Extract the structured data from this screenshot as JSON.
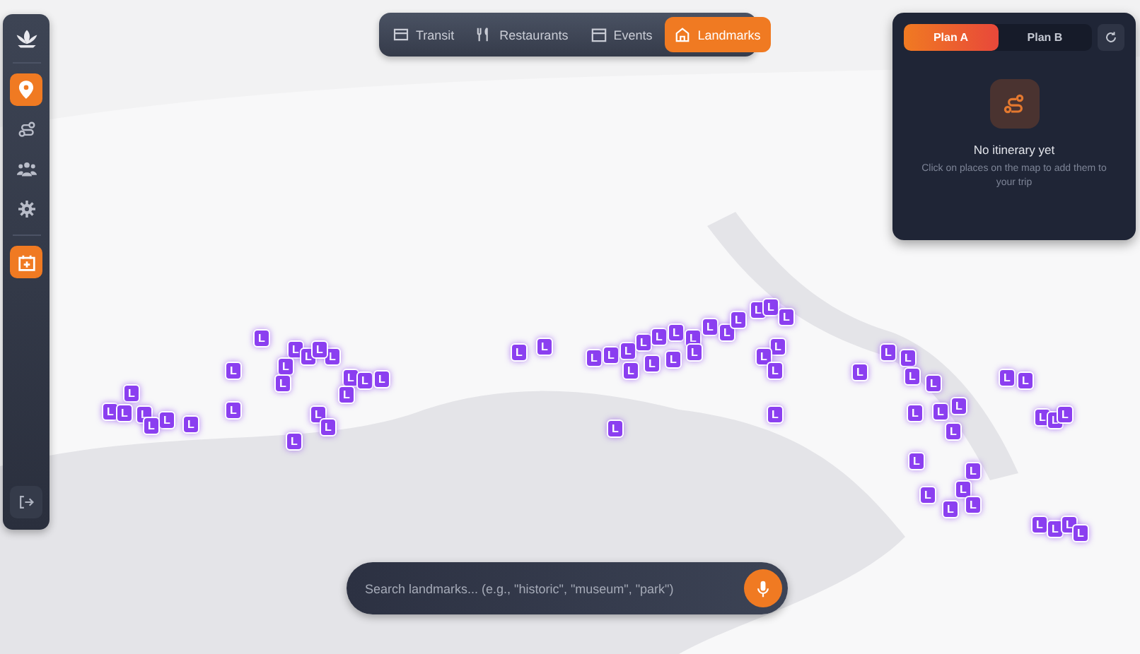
{
  "sidebar": {
    "items": [
      {
        "kind": "pin",
        "selected": true
      },
      {
        "kind": "route",
        "selected": false
      },
      {
        "kind": "group",
        "selected": false
      },
      {
        "kind": "settings",
        "selected": false
      }
    ],
    "calendar_button": {
      "selected": true
    }
  },
  "category_tabs": [
    {
      "label": "Transit",
      "kind": "transit",
      "selected": false
    },
    {
      "label": "Restaurants",
      "kind": "food",
      "selected": false
    },
    {
      "label": "Events",
      "kind": "calendar",
      "selected": false
    },
    {
      "label": "Landmarks",
      "kind": "landmark",
      "selected": true
    }
  ],
  "plan_panel": {
    "tabs": [
      {
        "label": "Plan A",
        "selected": true
      },
      {
        "label": "Plan B",
        "selected": false
      }
    ],
    "empty_title": "No itinerary yet",
    "empty_text": "Click on places on the map to add them to your trip"
  },
  "search": {
    "placeholder": "Search landmarks... (e.g., \"historic\", \"museum\", \"park\")"
  },
  "markers": [
    {
      "label": "L"
    },
    {
      "label": "L"
    },
    {
      "label": "L"
    },
    {
      "label": "L"
    },
    {
      "label": "L"
    },
    {
      "label": "L"
    },
    {
      "label": "L"
    },
    {
      "label": "L"
    },
    {
      "label": "L"
    },
    {
      "label": "L"
    },
    {
      "label": "L"
    },
    {
      "label": "L"
    },
    {
      "label": "L"
    },
    {
      "label": "L"
    },
    {
      "label": "L"
    },
    {
      "label": "L"
    },
    {
      "label": "L"
    },
    {
      "label": "L"
    },
    {
      "label": "L"
    },
    {
      "label": "L"
    },
    {
      "label": "L"
    },
    {
      "label": "L"
    },
    {
      "label": "L"
    },
    {
      "label": "L"
    },
    {
      "label": "L"
    },
    {
      "label": "L"
    },
    {
      "label": "L"
    },
    {
      "label": "L"
    },
    {
      "label": "L"
    },
    {
      "label": "L"
    },
    {
      "label": "L"
    },
    {
      "label": "L"
    },
    {
      "label": "L"
    },
    {
      "label": "L"
    },
    {
      "label": "L"
    },
    {
      "label": "L"
    },
    {
      "label": "L"
    },
    {
      "label": "L"
    },
    {
      "label": "L"
    },
    {
      "label": "L"
    },
    {
      "label": "L"
    },
    {
      "label": "L"
    },
    {
      "label": "L"
    },
    {
      "label": "L"
    },
    {
      "label": "L"
    },
    {
      "label": "L"
    },
    {
      "label": "L"
    },
    {
      "label": "L"
    },
    {
      "label": "L"
    },
    {
      "label": "L"
    },
    {
      "label": "L"
    },
    {
      "label": "L"
    },
    {
      "label": "L"
    },
    {
      "label": "L"
    },
    {
      "label": "L"
    },
    {
      "label": "L"
    },
    {
      "label": "L"
    },
    {
      "label": "L"
    },
    {
      "label": "L"
    },
    {
      "label": "L"
    },
    {
      "label": "L"
    },
    {
      "label": "L"
    },
    {
      "label": "L"
    },
    {
      "label": "L"
    },
    {
      "label": "L"
    },
    {
      "label": "L"
    },
    {
      "label": "L"
    },
    {
      "label": "L"
    },
    {
      "label": "L"
    },
    {
      "label": "L"
    },
    {
      "label": "L"
    }
  ]
}
